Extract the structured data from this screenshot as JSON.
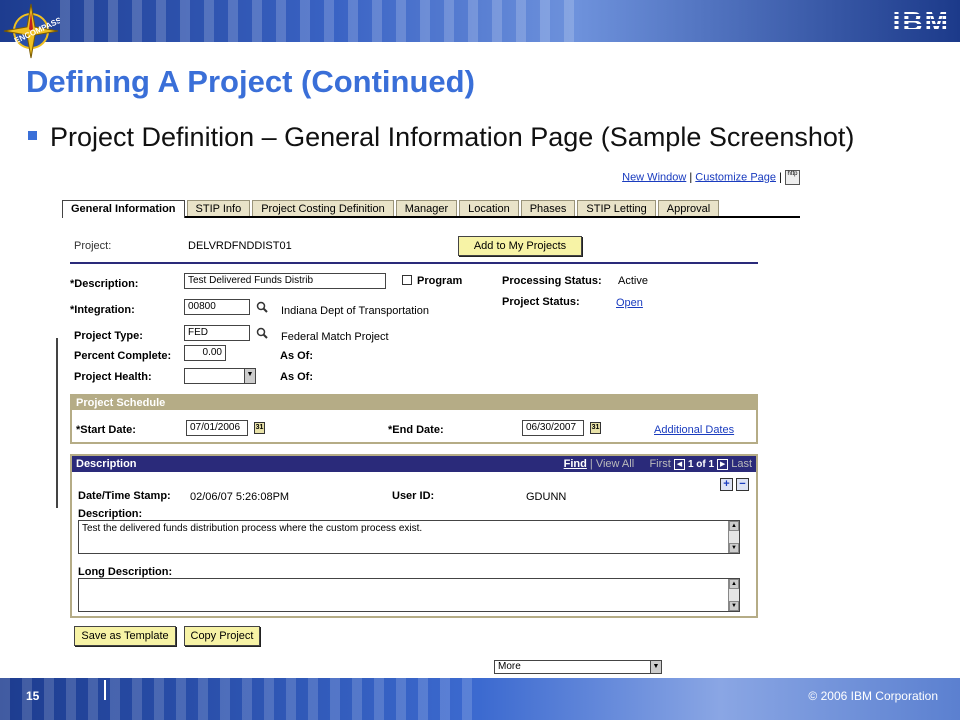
{
  "slide": {
    "title": "Defining A Project (Continued)",
    "bullet": "Project Definition – General Information Page (Sample Screenshot)",
    "page_number": "15",
    "copyright": "© 2006 IBM Corporation",
    "brand": "IBM",
    "accent_color": "#3a6fd8"
  },
  "app": {
    "top_links": {
      "new_window": "New Window",
      "customize_page": "Customize Page",
      "separator": "|",
      "http_icon": "http"
    },
    "tabs": [
      {
        "label": "General Information",
        "active": true
      },
      {
        "label": "STIP Info"
      },
      {
        "label": "Project Costing Definition"
      },
      {
        "label": "Manager"
      },
      {
        "label": "Location"
      },
      {
        "label": "Phases"
      },
      {
        "label": "STIP Letting"
      },
      {
        "label": "Approval"
      }
    ],
    "project_label": "Project:",
    "project_value": "DELVRDFNDDIST01",
    "add_to_my_projects": "Add to My Projects",
    "description_label": "*Description:",
    "description_value": "Test Delivered Funds Distrib",
    "program_label": "Program",
    "processing_status_label": "Processing Status:",
    "processing_status_value": "Active",
    "project_status_label": "Project Status:",
    "project_status_value": "Open",
    "integration_label": "*Integration:",
    "integration_value": "00800",
    "integration_desc": "Indiana Dept of Transportation",
    "project_type_label": "Project Type:",
    "project_type_value": "FED",
    "project_type_desc": "Federal Match Project",
    "percent_complete_label": "Percent Complete:",
    "percent_complete_value": "0.00",
    "as_of_label_1": "As Of:",
    "project_health_label": "Project Health:",
    "as_of_label_2": "As Of:",
    "schedule": {
      "header": "Project Schedule",
      "start_label": "*Start Date:",
      "start_value": "07/01/2006",
      "end_label": "*End Date:",
      "end_value": "06/30/2007",
      "additional_dates": "Additional Dates",
      "cal_icon": "31"
    },
    "description_section": {
      "header": "Description",
      "find": "Find",
      "view_all": "| View All",
      "first": "First",
      "counter": "1 of 1",
      "last": "Last",
      "date_label": "Date/Time Stamp:",
      "date_value": "02/06/07  5:26:08PM",
      "user_label": "User ID:",
      "user_value": "GDUNN",
      "desc_label": "Description:",
      "desc_value": "Test the delivered funds distribution process where the custom process exist.",
      "long_desc_label": "Long Description:",
      "long_desc_value": "",
      "plus": "+",
      "minus": "−"
    },
    "save_as_template": "Save as Template",
    "copy_project": "Copy Project",
    "more_select": "More"
  }
}
